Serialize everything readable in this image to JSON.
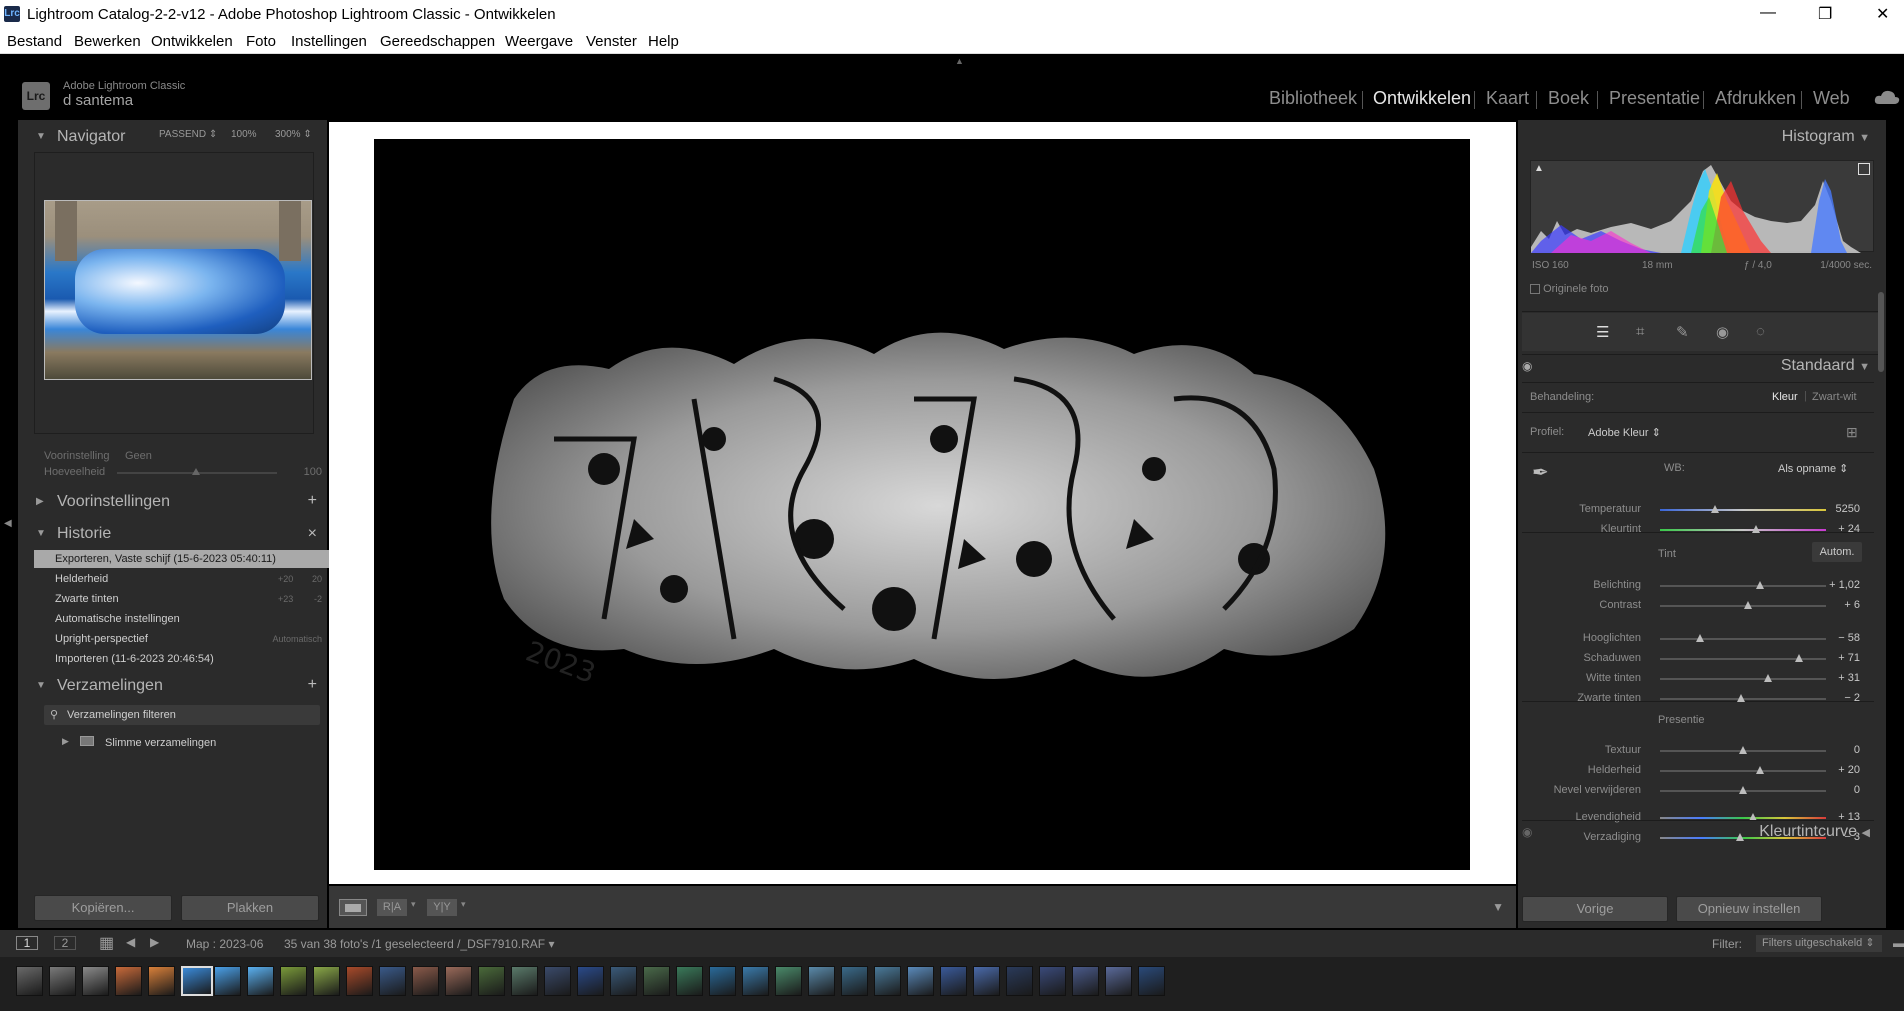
{
  "window": {
    "title": "Lightroom Catalog-2-2-v12 - Adobe Photoshop Lightroom Classic - Ontwikkelen",
    "app_icon": "Lrc"
  },
  "menu": [
    "Bestand",
    "Bewerken",
    "Ontwikkelen",
    "Foto",
    "Instellingen",
    "Gereedschappen",
    "Weergave",
    "Venster",
    "Help"
  ],
  "identity": {
    "logo": "Lrc",
    "product": "Adobe Lightroom Classic",
    "user": "d santema"
  },
  "modules": [
    "Bibliotheek",
    "Ontwikkelen",
    "Kaart",
    "Boek",
    "Presentatie",
    "Afdrukken",
    "Web"
  ],
  "active_module": "Ontwikkelen",
  "navigator": {
    "title": "Navigator",
    "zoom_options": [
      "PASSEND ⇕",
      "100%",
      "300% ⇕"
    ]
  },
  "preset_amount": {
    "label_preset": "Voorinstelling",
    "value_preset": "Geen",
    "label_amount": "Hoeveelheid",
    "value_amount": "100"
  },
  "presets_panel": {
    "title": "Voorinstellingen",
    "action": "+"
  },
  "history": {
    "title": "Historie",
    "close": "×",
    "items": [
      {
        "name": "Exporteren, Vaste schijf (15-6-2023 05:40:11)",
        "a": "",
        "b": ""
      },
      {
        "name": "Helderheid",
        "a": "+20",
        "b": "20"
      },
      {
        "name": "Zwarte tinten",
        "a": "+23",
        "b": "-2"
      },
      {
        "name": "Automatische instellingen",
        "a": "",
        "b": ""
      },
      {
        "name": "Upright-perspectief",
        "a": "",
        "b": "Automatisch"
      },
      {
        "name": "Importeren  (11-6-2023 20:46:54)",
        "a": "",
        "b": ""
      }
    ]
  },
  "collections": {
    "title": "Verzamelingen",
    "action": "+",
    "filter": "Verzamelingen filteren",
    "smart": "Slimme verzamelingen"
  },
  "left_buttons": {
    "copy": "Kopiëren...",
    "paste": "Plakken"
  },
  "histogram": {
    "title": "Histogram",
    "iso": "ISO 160",
    "focal": "18 mm",
    "aperture": "ƒ / 4,0",
    "shutter": "1/4000 sec.",
    "original": "Originele foto"
  },
  "basic": {
    "title": "Standaard",
    "treatment_label": "Behandeling:",
    "treatment_color": "Kleur",
    "treatment_bw": "Zwart-wit",
    "profile_label": "Profiel:",
    "profile_value": "Adobe Kleur ⇕",
    "wb_label": "WB:",
    "wb_value": "Als opname ⇕",
    "tone_label": "Tint",
    "auto": "Autom.",
    "presence_label": "Presentie"
  },
  "sliders": [
    {
      "label": "Temperatuur",
      "value": "5250",
      "pos": 0.33
    },
    {
      "label": "Kleurtint",
      "value": "+ 24",
      "pos": 0.58
    },
    {
      "label": "Belichting",
      "value": "+ 1,02",
      "pos": 0.6
    },
    {
      "label": "Contrast",
      "value": "+ 6",
      "pos": 0.53
    },
    {
      "label": "Hooglichten",
      "value": "− 58",
      "pos": 0.24
    },
    {
      "label": "Schaduwen",
      "value": "+ 71",
      "pos": 0.84
    },
    {
      "label": "Witte tinten",
      "value": "+ 31",
      "pos": 0.65
    },
    {
      "label": "Zwarte tinten",
      "value": "− 2",
      "pos": 0.49
    },
    {
      "label": "Textuur",
      "value": "0",
      "pos": 0.5
    },
    {
      "label": "Helderheid",
      "value": "+ 20",
      "pos": 0.6
    },
    {
      "label": "Nevel verwijderen",
      "value": "0",
      "pos": 0.5
    },
    {
      "label": "Levendigheid",
      "value": "+ 13",
      "pos": 0.56
    },
    {
      "label": "Verzadiging",
      "value": "− 3",
      "pos": 0.48
    }
  ],
  "tone_curve": {
    "title": "Kleurtintcurve"
  },
  "right_buttons": {
    "prev": "Vorige",
    "reset": "Opnieuw instellen"
  },
  "filmbar": {
    "page1": "1",
    "page2": "2",
    "source": "Map : 2023-06",
    "count": "35 van 38 foto's /1 geselecteerd /_DSF7910.RAF ▾",
    "filter_label": "Filter:",
    "filter_value": "Filters uitgeschakeld ⇕"
  },
  "toolbar": {
    "ra": "R|A",
    "yy": "Y|Y"
  }
}
